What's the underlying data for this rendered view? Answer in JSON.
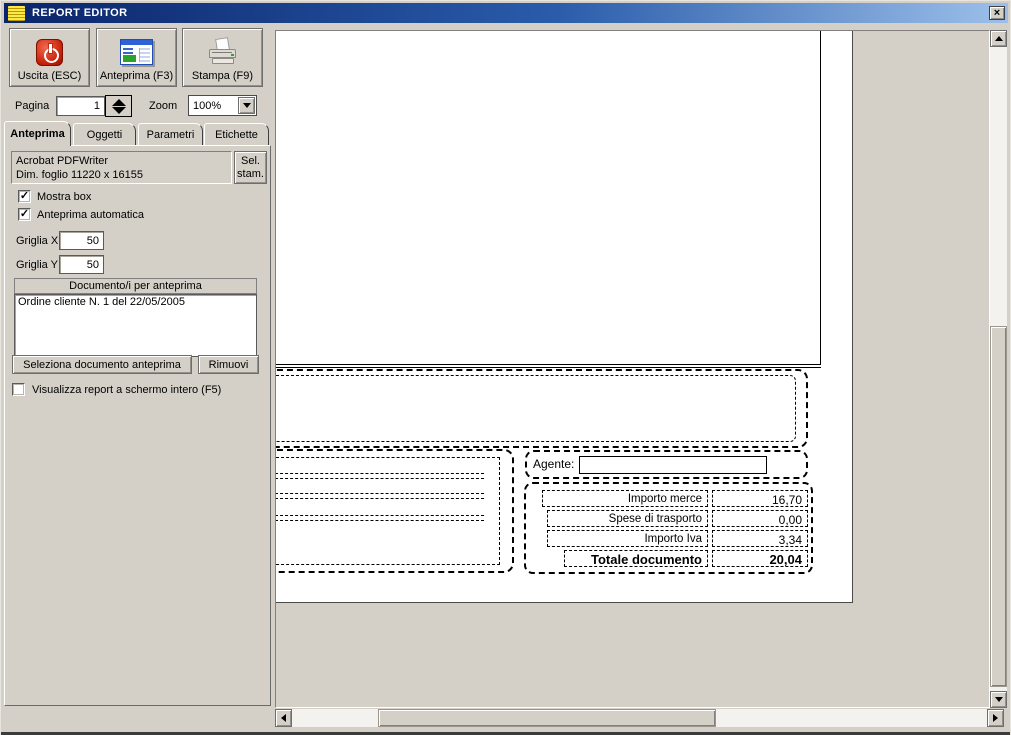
{
  "window": {
    "title": "REPORT EDITOR",
    "close_glyph": "×"
  },
  "colors": {
    "window_bg": "#d4d0c8",
    "titlebar_start": "#0a246a",
    "titlebar_end": "#9cc0ea",
    "page_bg": "#ffffff"
  },
  "icons": {
    "check": "✓",
    "app": "report-stack-icon"
  },
  "toolbar": {
    "buttons": [
      {
        "label": "Uscita (ESC)",
        "icon": "power-icon"
      },
      {
        "label": "Anteprima (F3)",
        "icon": "report-preview-icon"
      },
      {
        "label": "Stampa (F9)",
        "icon": "printer-icon"
      }
    ],
    "page_label": "Pagina",
    "page_value": "1",
    "zoom_label": "Zoom",
    "zoom_value": "100%"
  },
  "tabs": [
    {
      "label": "Anteprima",
      "active": true
    },
    {
      "label": "Oggetti",
      "active": false
    },
    {
      "label": "Parametri",
      "active": false
    },
    {
      "label": "Etichette",
      "active": false
    }
  ],
  "panel": {
    "printer_line1": "Acrobat PDFWriter",
    "printer_line2": "Dim. foglio 11220 x 16155",
    "sel_stam_line1": "Sel.",
    "sel_stam_line2": "stam.",
    "mostra_box_label": "Mostra box",
    "mostra_box_checked": true,
    "anteprima_auto_label": "Anteprima automatica",
    "anteprima_auto_checked": true,
    "griglia_x_label": "Griglia X",
    "griglia_x_value": "50",
    "griglia_y_label": "Griglia Y",
    "griglia_y_value": "50",
    "doc_header": "Documento/i per anteprima",
    "doc_items": [
      "Ordine cliente N. 1 del 22/05/2005"
    ],
    "select_doc_label": "Seleziona documento anteprima",
    "remove_label": "Rimuovi",
    "fullscreen_label": "Visualizza report a schermo intero (F5)",
    "fullscreen_checked": false
  },
  "preview": {
    "agente_label": "Agente:",
    "agente_value": "",
    "totals": [
      {
        "label": "Importo merce",
        "value": "16,70"
      },
      {
        "label": "Spese di trasporto",
        "value": "0,00"
      },
      {
        "label": "Importo Iva",
        "value": "3,34"
      },
      {
        "label": "Totale documento",
        "value": "20,04"
      }
    ]
  }
}
